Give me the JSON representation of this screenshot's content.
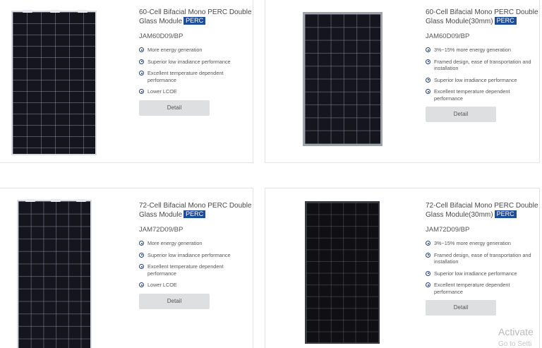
{
  "products": [
    {
      "title": "60-Cell Bifacial Mono PERC Double Glass Module",
      "badge": "PERC",
      "model": "JAM60D09/BP",
      "features": [
        "More energy generation",
        "Superior low irradiance performance",
        "Excellent temperature dependent performance",
        "Lower LCOE"
      ],
      "button": "Detail"
    },
    {
      "title": "60-Cell Bifacial Mono PERC Double Glass Module(30mm)",
      "badge": "PERC",
      "model": "JAM60D09/BP",
      "features": [
        "3%~15% more energy generation",
        "Framed design, ease of transportation and installation",
        "Superior low irradiance performance",
        "Excellent temperature dependent performance"
      ],
      "button": "Detail"
    },
    {
      "title": "72-Cell Bifacial Mono PERC Double Glass Module",
      "badge": "PERC",
      "model": "JAM72D09/BP",
      "features": [
        "More energy generation",
        "Superior low irradiance performance",
        "Excellent temperature dependent performance",
        "Lower LCOE"
      ],
      "button": "Detail"
    },
    {
      "title": "72-Cell Bifacial Mono PERC Double Glass Module(30mm)",
      "badge": "PERC",
      "model": "JAM72D09/BP",
      "features": [
        "3%~15% more energy generation",
        "Framed design, ease of transportation and installation",
        "Superior low irradiance performance",
        "Excellent temperature dependent performance"
      ],
      "button": "Detail"
    }
  ],
  "watermark": {
    "title": "Activate",
    "subtitle": "Go to Setti"
  },
  "colors": {
    "badge": "#1f4e96",
    "bullet": "#23407a",
    "button": "#dedfe1"
  }
}
